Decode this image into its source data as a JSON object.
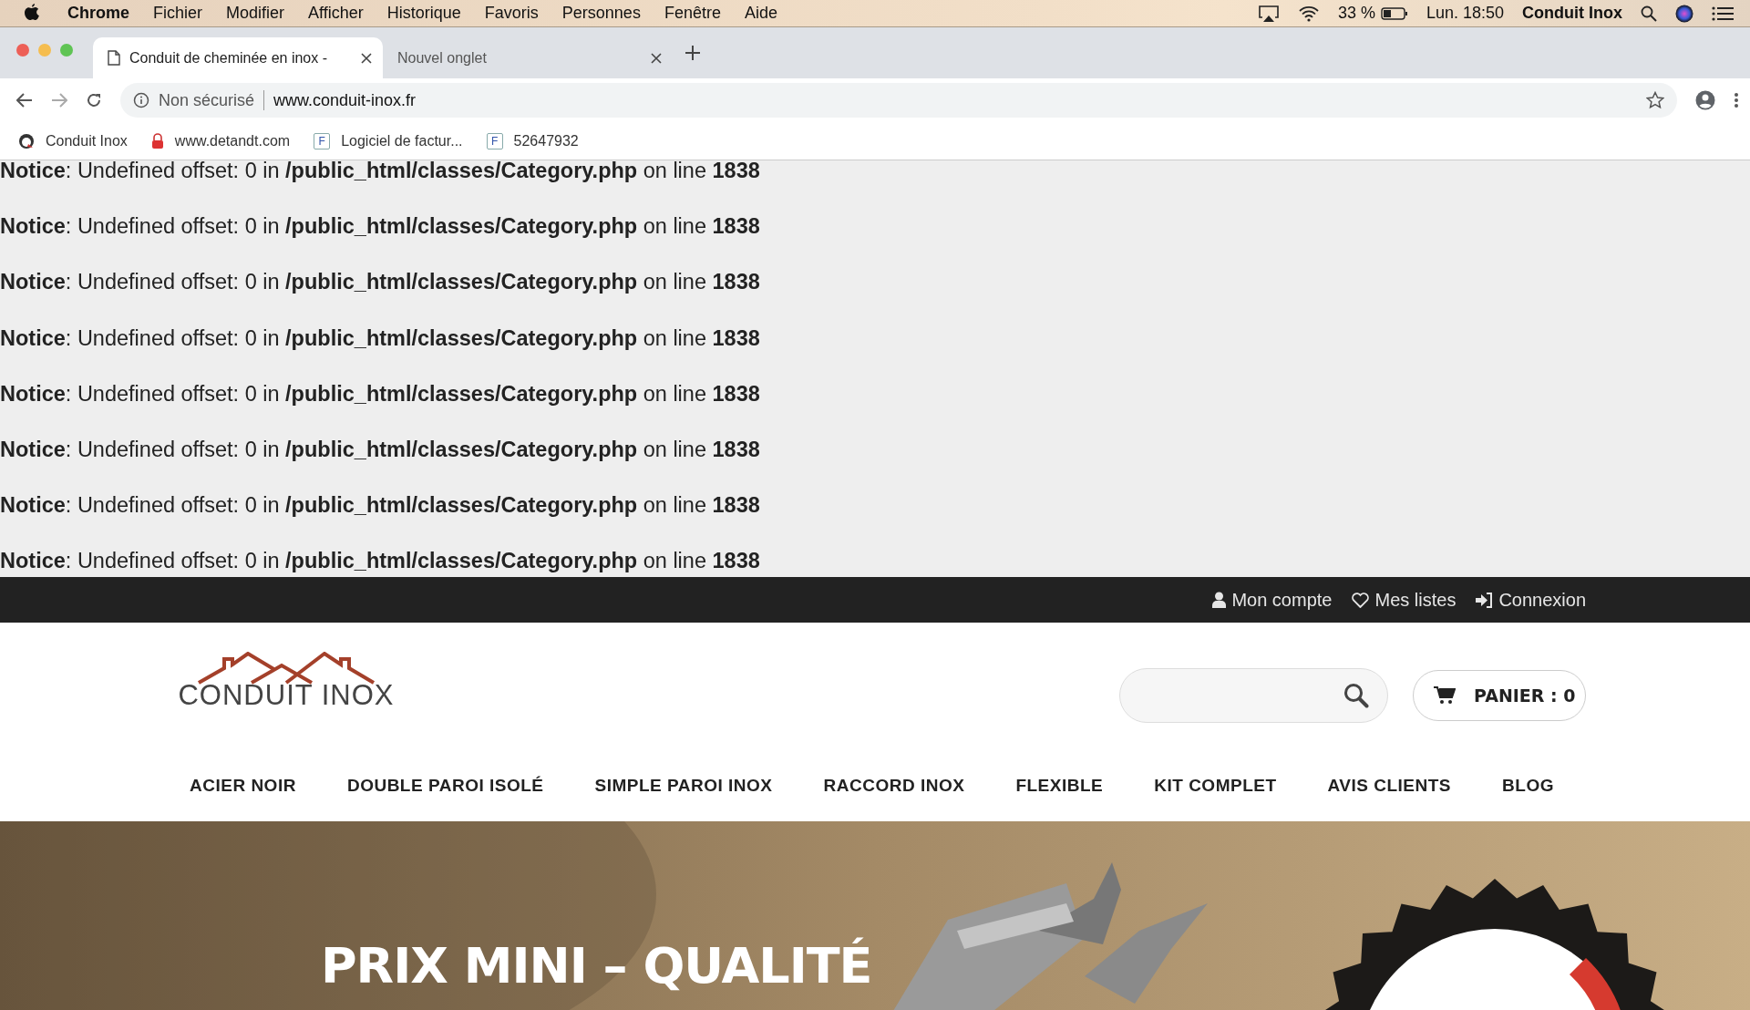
{
  "menubar": {
    "app": "Chrome",
    "menus": [
      "Fichier",
      "Modifier",
      "Afficher",
      "Historique",
      "Favoris",
      "Personnes",
      "Fenêtre",
      "Aide"
    ],
    "battery": "33 %",
    "clock": "Lun. 18:50",
    "user": "Conduit Inox"
  },
  "browser": {
    "tabs": [
      {
        "title": "Conduit de cheminée en inox -",
        "selected": true
      },
      {
        "title": "Nouvel onglet",
        "selected": false
      }
    ],
    "security": "Non sécurisé",
    "url": "www.conduit-inox.fr",
    "bookmarks": [
      {
        "label": "Conduit Inox",
        "kind": "logo"
      },
      {
        "label": "www.detandt.com",
        "kind": "pin"
      },
      {
        "label": "Logiciel de factur...",
        "kind": "letter",
        "letter": "F"
      },
      {
        "label": "52647932",
        "kind": "letter",
        "letter": "F"
      }
    ]
  },
  "notices": [
    "**Notice**: Undefined offset: 0 in **/public_html/classes/Category.php** on line **1838**",
    "**Notice**: Undefined offset: 0 in **/public_html/classes/Category.php** on line **1838**",
    "**Notice**: Undefined offset: 0 in **/public_html/classes/Category.php** on line **1838**",
    "**Notice**: Undefined offset: 0 in **/public_html/classes/Category.php** on line **1838**",
    "**Notice**: Undefined offset: 0 in **/public_html/classes/Category.php** on line **1838**",
    "**Notice**: Undefined offset: 0 in **/public_html/classes/Category.php** on line **1838**",
    "**Notice**: Undefined offset: 0 in **/public_html/classes/Category.php** on line **1838**",
    "**Notice**: Undefined offset: 0 in **/public_html/classes/Category.php** on line **1838**"
  ],
  "topbar": [
    {
      "label": "Mon compte",
      "kind": "user"
    },
    {
      "label": "Mes listes",
      "kind": "heart"
    },
    {
      "label": "Connexion",
      "kind": "login"
    }
  ],
  "header": {
    "logo": "CONDUIT INOX",
    "cart": "PANIER : 0"
  },
  "nav": [
    "ACIER NOIR",
    "DOUBLE PAROI ISOLÉ",
    "SIMPLE PAROI INOX",
    "RACCORD INOX",
    "FLEXIBLE",
    "KIT COMPLET",
    "AVIS CLIENTS",
    "BLOG"
  ],
  "hero": {
    "kind": "picture",
    "headline": "PRIX MINI – QUALITÉ"
  }
}
